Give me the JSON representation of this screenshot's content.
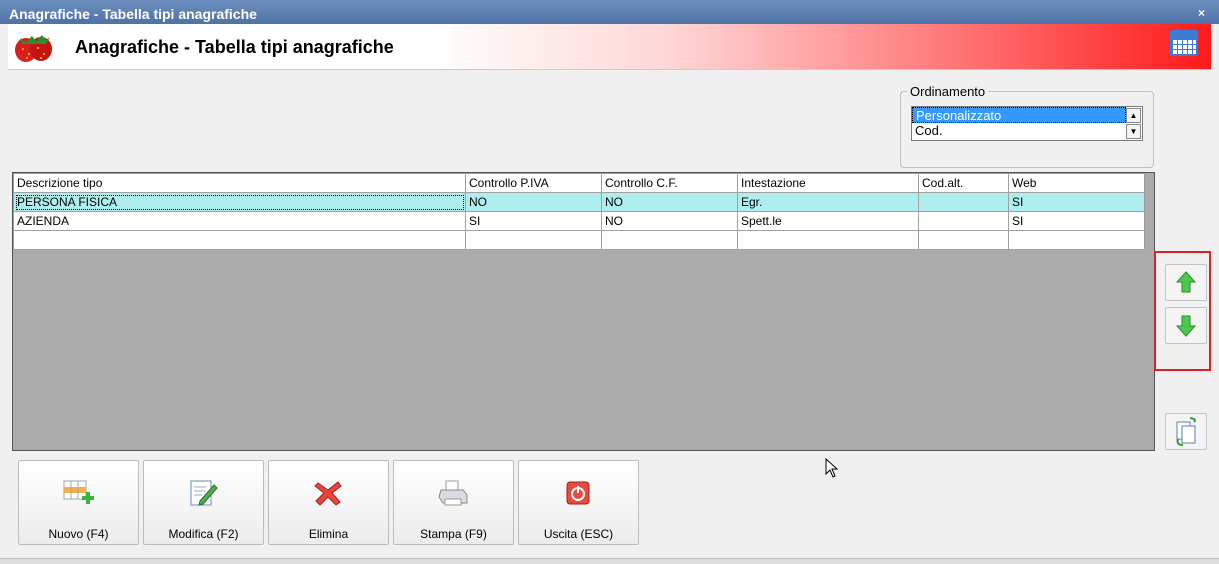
{
  "window": {
    "title": "Anagrafiche - Tabella tipi anagrafiche",
    "close_glyph": "×"
  },
  "banner": {
    "title": "Anagrafiche - Tabella tipi anagrafiche",
    "logo_icon": "strawberry-logo",
    "right_icon": "calendar-icon"
  },
  "ordering": {
    "legend": "Ordinamento",
    "options": [
      "Personalizzato",
      "Cod."
    ],
    "selected": "Personalizzato"
  },
  "table": {
    "columns": [
      "Descrizione tipo",
      "Controllo P.IVA",
      "Controllo C.F.",
      "Intestazione",
      "Cod.alt.",
      "Web"
    ],
    "rows": [
      [
        "PERSONA FISICA",
        "NO",
        "NO",
        "Egr.",
        "",
        "SI"
      ],
      [
        "AZIENDA",
        "SI",
        "NO",
        "Spett.le",
        "",
        "SI"
      ],
      [
        "",
        "",
        "",
        "",
        "",
        ""
      ]
    ],
    "selected_row": 0
  },
  "side_buttons": {
    "move_up_icon": "arrow-up-icon",
    "move_down_icon": "arrow-down-icon",
    "refresh_icon": "refresh-icon"
  },
  "buttons": {
    "new": "Nuovo (F4)",
    "edit": "Modifica (F2)",
    "delete": "Elimina",
    "print": "Stampa (F9)",
    "exit": "Uscita (ESC)"
  },
  "colors": {
    "selected_row": "#aeeeee",
    "list_selection": "#3399ff",
    "highlight_border": "#e02020"
  }
}
